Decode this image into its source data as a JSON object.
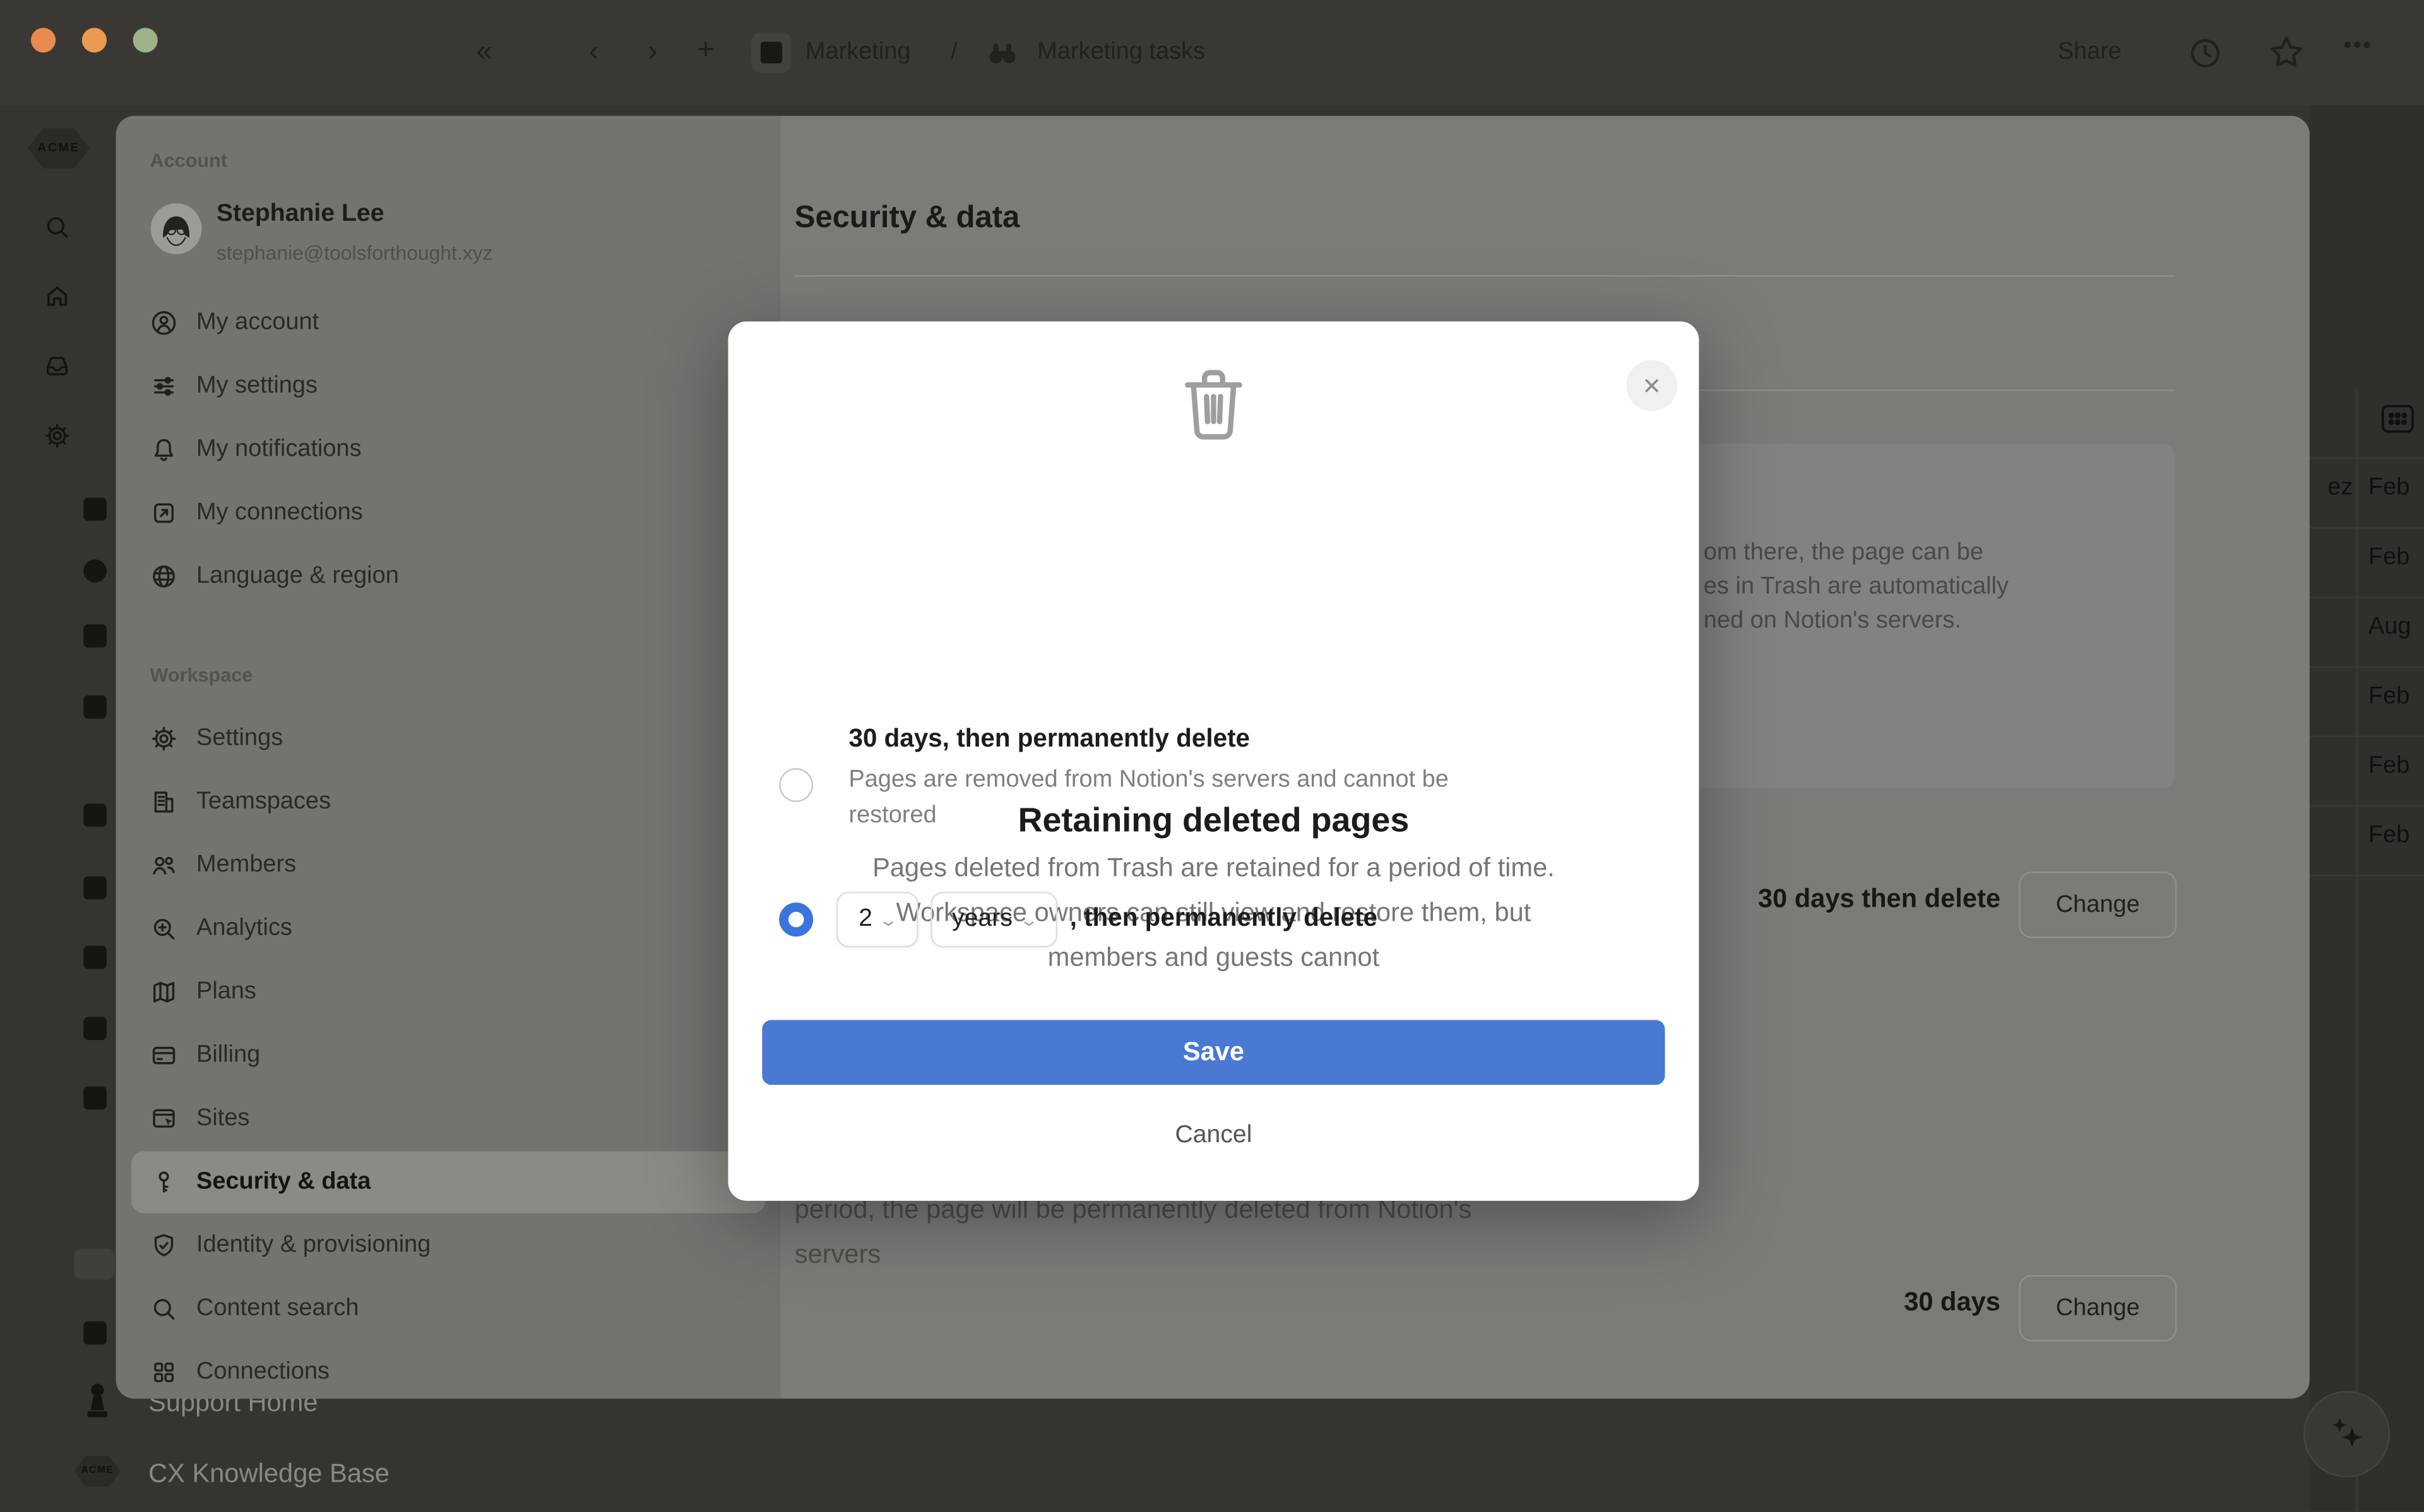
{
  "colors": {
    "accent_blue": "#4a79d4",
    "radio_blue": "#3b74dd",
    "traffic_red": "#e98b4e",
    "traffic_yellow": "#eb9b51",
    "traffic_green": "#9db289"
  },
  "titlebar": {
    "breadcrumb_team": "Marketing",
    "breadcrumb_sep": "/",
    "breadcrumb_page": "Marketing tasks",
    "share_label": "Share"
  },
  "app_sidebar": {
    "workspace_logo": "ACME",
    "support_home": "Support Home",
    "knowledge_base": "CX Knowledge Base",
    "nav_icons": [
      "search",
      "home",
      "inbox",
      "gear"
    ],
    "page_icons": [
      "corner-arrow",
      "eight-ball",
      "box",
      "crate",
      "plant",
      "carousel",
      "card-box",
      "projector",
      "guitar",
      "people-badge",
      "feather"
    ]
  },
  "settings": {
    "account_header": "Account",
    "user_name": "Stephanie Lee",
    "user_email": "stephanie@toolsforthought.xyz",
    "account_items": [
      {
        "icon": "person-circle",
        "label": "My account"
      },
      {
        "icon": "sliders",
        "label": "My settings"
      },
      {
        "icon": "bell",
        "label": "My notifications"
      },
      {
        "icon": "arrow-out-box",
        "label": "My connections"
      },
      {
        "icon": "globe",
        "label": "Language & region"
      }
    ],
    "workspace_header": "Workspace",
    "workspace_items": [
      {
        "icon": "gear",
        "label": "Settings"
      },
      {
        "icon": "building",
        "label": "Teamspaces"
      },
      {
        "icon": "people",
        "label": "Members"
      },
      {
        "icon": "magnifier-sparkle",
        "label": "Analytics"
      },
      {
        "icon": "map",
        "label": "Plans"
      },
      {
        "icon": "credit-card",
        "label": "Billing"
      },
      {
        "icon": "browser-cursor",
        "label": "Sites"
      },
      {
        "icon": "key",
        "label": "Security & data",
        "active": true
      },
      {
        "icon": "shield-check",
        "label": "Identity & provisioning"
      },
      {
        "icon": "magnifier",
        "label": "Content search"
      },
      {
        "icon": "grid",
        "label": "Connections"
      }
    ]
  },
  "page": {
    "title": "Security & data",
    "info_fragments": [
      "om there, the page can be",
      "es in Trash are automatically",
      "ned on Notion's servers."
    ],
    "rows": [
      {
        "value": "30 days then delete",
        "button": "Change"
      },
      {
        "value": "30 days",
        "button": "Change"
      }
    ],
    "footer_line1": "period, the page will be permanently deleted from Notion's",
    "footer_line2": "servers"
  },
  "table": {
    "name_fragment": "ez",
    "date_rows": [
      "Feb",
      "Feb",
      "Aug",
      "Feb",
      "Feb",
      "Feb"
    ]
  },
  "modal": {
    "title": "Retaining deleted pages",
    "desc_lines": [
      "Pages deleted from Trash are retained for a period of time.",
      "Workspace owners can still view and restore them, but",
      "members and guests cannot"
    ],
    "option1": {
      "label": "30 days, then permanently delete",
      "desc_line1": "Pages are removed from Notion's servers and cannot be",
      "desc_line2": "restored"
    },
    "option2": {
      "value": "2",
      "unit": "years",
      "suffix": ", then permanently delete"
    },
    "save_label": "Save",
    "cancel_label": "Cancel"
  }
}
